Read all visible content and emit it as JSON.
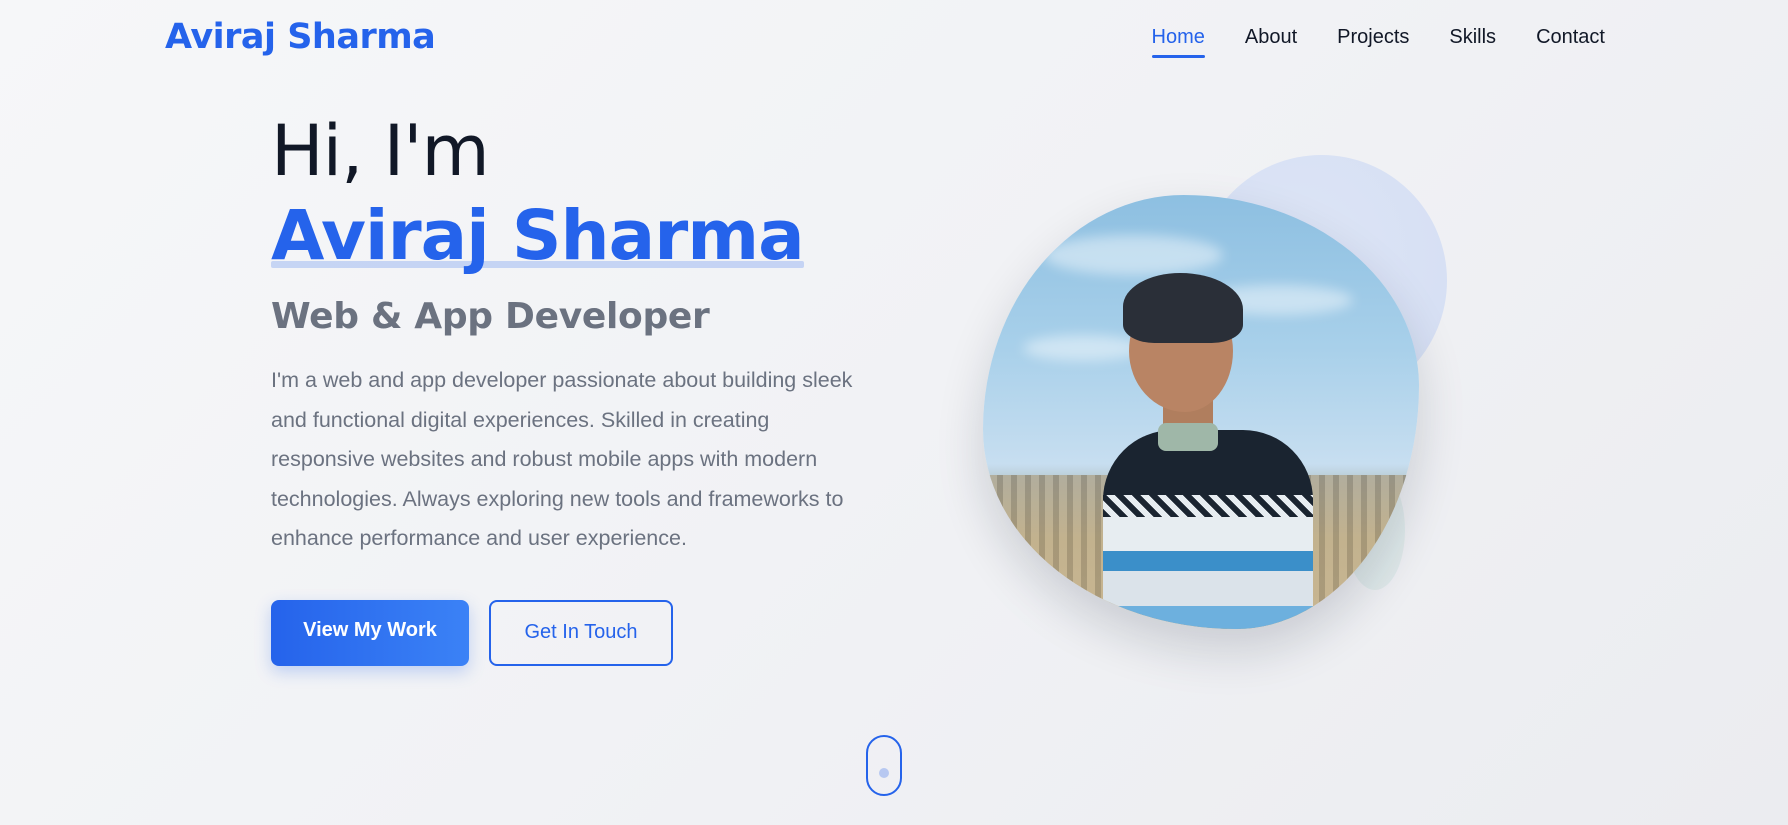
{
  "nav": {
    "logo": "Aviraj Sharma",
    "links": [
      {
        "label": "Home",
        "active": true
      },
      {
        "label": "About",
        "active": false
      },
      {
        "label": "Projects",
        "active": false
      },
      {
        "label": "Skills",
        "active": false
      },
      {
        "label": "Contact",
        "active": false
      }
    ]
  },
  "hero": {
    "greeting": "Hi, I'm",
    "name": "Aviraj Sharma",
    "role": "Web & App Developer",
    "description": "I'm a web and app developer passionate about building sleek and functional digital experiences. Skilled in creating responsive websites and robust mobile apps with modern technologies. Always exploring new tools and frameworks to enhance performance and user experience.",
    "primary_button": "View My Work",
    "secondary_button": "Get In Touch"
  },
  "colors": {
    "accent": "#2563eb",
    "heading": "#111827",
    "muted": "#6b7280"
  },
  "icons": {
    "scroll": "mouse-scroll-icon"
  }
}
